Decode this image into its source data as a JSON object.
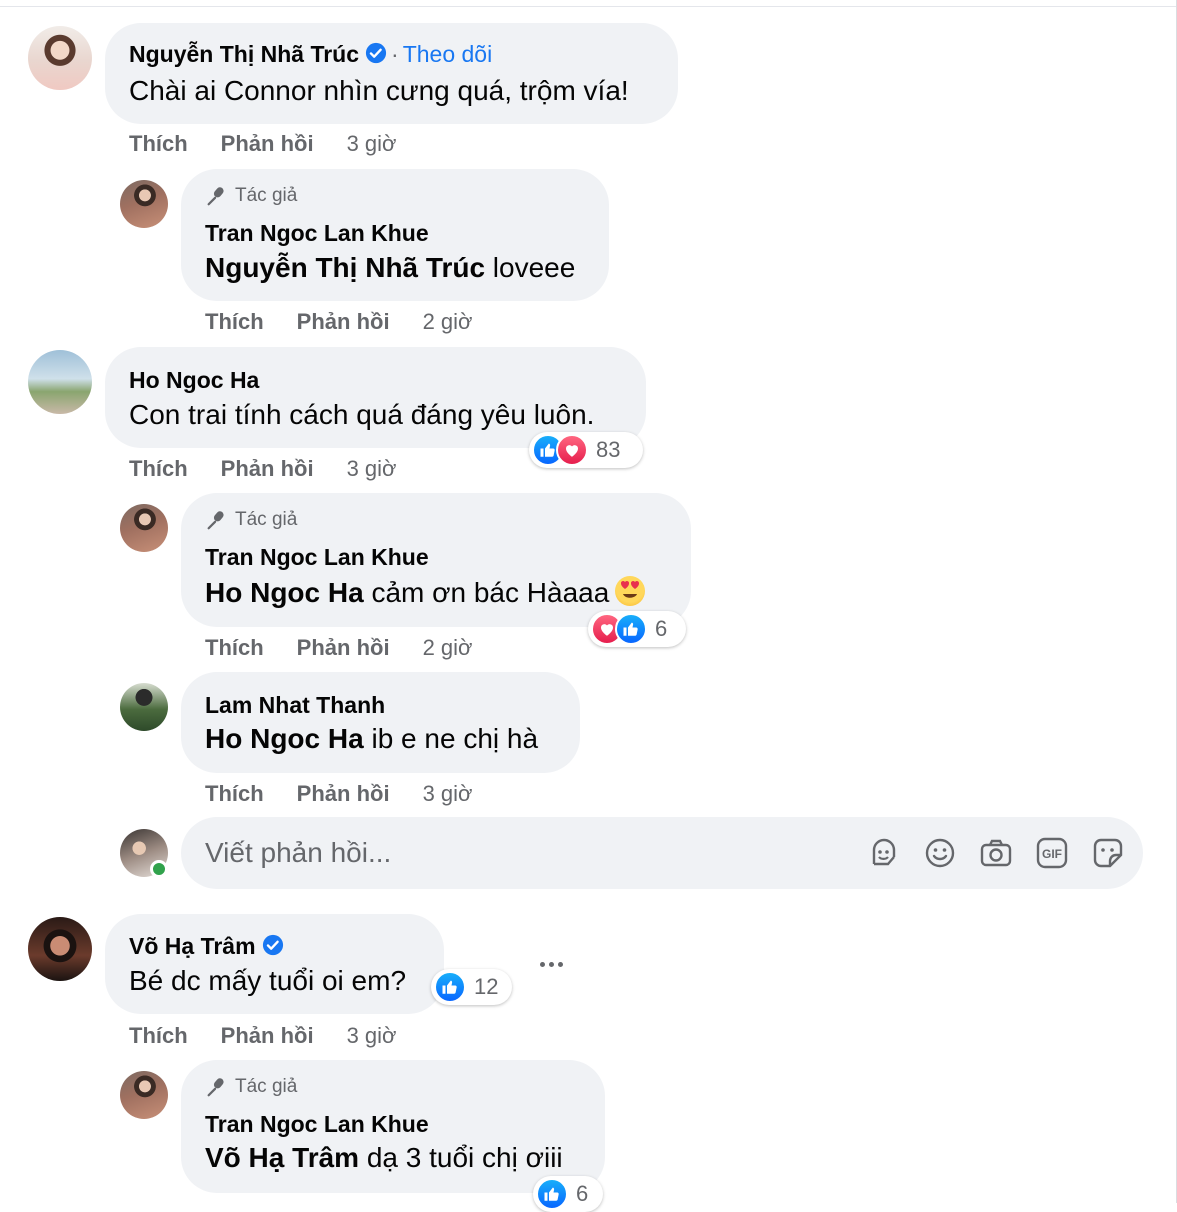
{
  "comments": [
    {
      "author": "Nguyễn Thị Nhã Trúc",
      "follow_label": "Theo dõi",
      "follow_sep": "·",
      "text": "Chài ai Connor nhìn cưng quá, trộm vía!",
      "actions": {
        "like": "Thích",
        "reply": "Phản hồi",
        "time": "3 giờ"
      },
      "replies": [
        {
          "author_badge": "Tác giả",
          "author": "Tran Ngoc Lan Khue",
          "mention": "Nguyễn Thị Nhã Trúc",
          "text": " loveee",
          "actions": {
            "like": "Thích",
            "reply": "Phản hồi",
            "time": "2 giờ"
          }
        }
      ]
    },
    {
      "author": "Ho Ngoc Ha",
      "text": "Con trai tính cách quá đáng yêu luôn.",
      "reactions_count": "83",
      "actions": {
        "like": "Thích",
        "reply": "Phản hồi",
        "time": "3 giờ"
      },
      "replies": [
        {
          "author_badge": "Tác giả",
          "author": "Tran Ngoc Lan Khue",
          "mention": "Ho Ngoc Ha",
          "text": " cảm ơn bác Hàaaa",
          "reactions_count": "6",
          "actions": {
            "like": "Thích",
            "reply": "Phản hồi",
            "time": "2 giờ"
          }
        },
        {
          "author": "Lam Nhat Thanh",
          "mention": "Ho Ngoc Ha",
          "text": " ib e ne chị hà",
          "actions": {
            "like": "Thích",
            "reply": "Phản hồi",
            "time": "3 giờ"
          }
        }
      ]
    },
    {
      "author": "Võ Hạ Trâm",
      "text": "Bé dc mấy tuổi oi em?",
      "reactions_count": "12",
      "actions": {
        "like": "Thích",
        "reply": "Phản hồi",
        "time": "3 giờ"
      },
      "replies": [
        {
          "author_badge": "Tác giả",
          "author": "Tran Ngoc Lan Khue",
          "mention": "Võ Hạ Trâm",
          "text": " dạ 3 tuổi chị ơiii",
          "reactions_count": "6"
        }
      ]
    }
  ],
  "reply_box": {
    "placeholder": "Viết phản hồi...",
    "tools": [
      "avatar-sticker-icon",
      "emoji-icon",
      "camera-icon",
      "gif-icon",
      "sticker-icon"
    ]
  },
  "colors": {
    "bubble": "#f0f2f5",
    "link": "#1877f2",
    "secondary_text": "#65676b",
    "like_blue": "#0866ff",
    "love_red": "#e61e4d",
    "online_green": "#31a24c"
  }
}
